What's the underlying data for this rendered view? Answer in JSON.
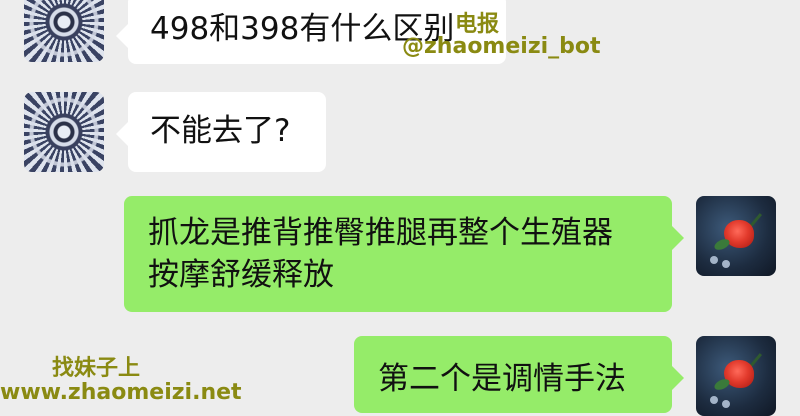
{
  "messages": [
    {
      "side": "left",
      "avatar": "mandala-avatar",
      "text": "498和398有什么区别"
    },
    {
      "side": "left",
      "avatar": "mandala-avatar",
      "text": "不能去了?"
    },
    {
      "side": "right",
      "avatar": "rose-avatar",
      "text_line1": "抓龙是推背推臀推腿再整个生殖器",
      "text_line2": "按摩舒缓释放"
    },
    {
      "side": "right",
      "avatar": "rose-avatar",
      "text": "第二个是调情手法"
    }
  ],
  "watermarks": {
    "top_line1": "电报",
    "top_line2": "@zhaomeizi_bot",
    "bottom_line1": "找妹子上",
    "bottom_line2": "www.zhaomeizi.net"
  },
  "colors": {
    "background": "#ededed",
    "incoming_bubble": "#ffffff",
    "outgoing_bubble": "#95ec69",
    "watermark": "#8a8a12"
  }
}
